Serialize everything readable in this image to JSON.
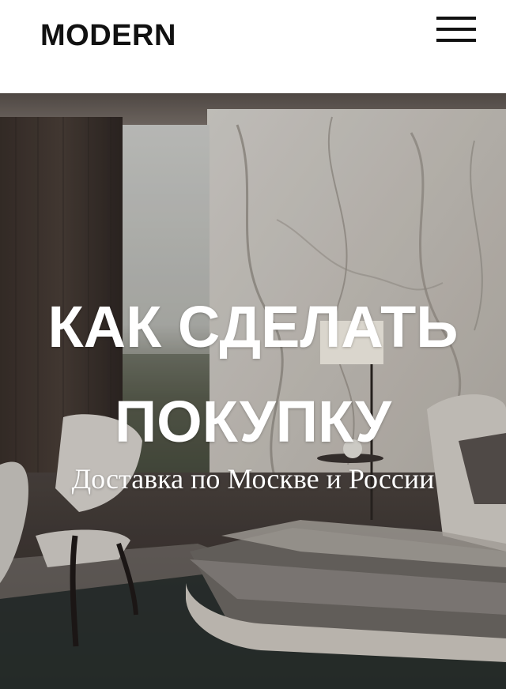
{
  "header": {
    "logo": "MODERN",
    "menu_icon": "hamburger-menu-icon"
  },
  "hero": {
    "title": "КАК СДЕЛАТЬ ПОКУПКУ",
    "subtitle": "Доставка по Москве и России",
    "image": "bedroom-interior-photo"
  }
}
